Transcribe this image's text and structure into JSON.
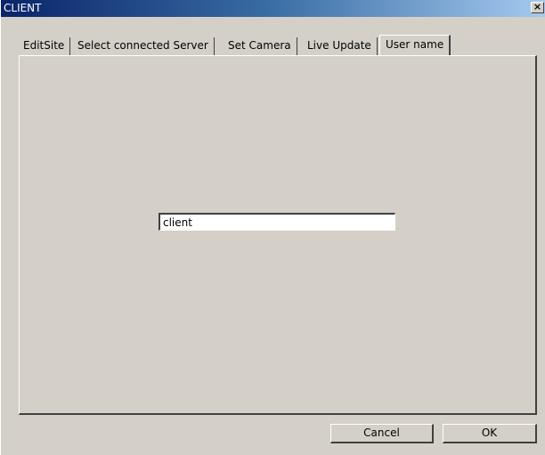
{
  "window": {
    "title": "CLIENT",
    "close_glyph": "×"
  },
  "tabs": [
    {
      "label": "EditSite",
      "active": false
    },
    {
      "label": "Select connected Server",
      "active": false
    },
    {
      "label": "Set Camera",
      "active": false
    },
    {
      "label": "Live Update",
      "active": false
    },
    {
      "label": "User name",
      "active": true
    }
  ],
  "user_name": {
    "value": "client"
  },
  "buttons": {
    "cancel_label": "Cancel",
    "ok_label": "OK"
  },
  "colors": {
    "titlebar_start": "#0a246a",
    "titlebar_end": "#a6caf0",
    "face": "#d4d0c8"
  }
}
